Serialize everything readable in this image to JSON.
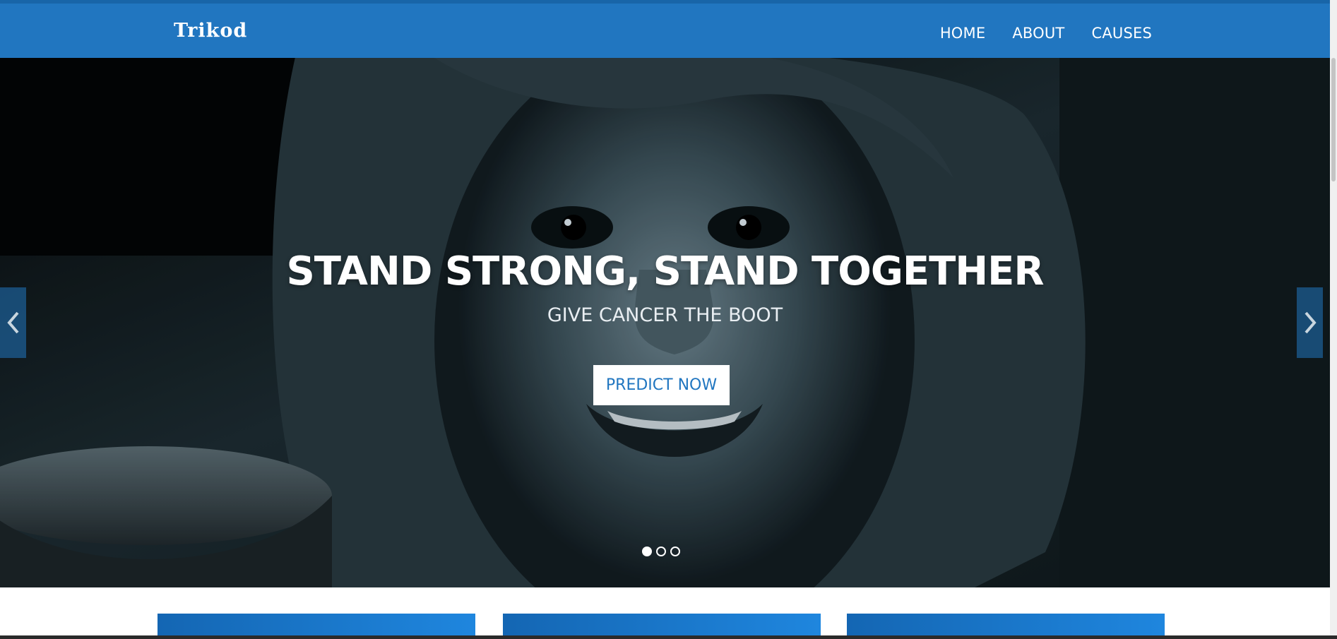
{
  "brand": {
    "logo_text": "Trikod"
  },
  "nav": {
    "items": [
      "HOME",
      "ABOUT",
      "CAUSES"
    ]
  },
  "hero": {
    "title": "STAND STRONG, STAND TOGETHER",
    "subtitle": "GIVE CANCER THE BOOT",
    "cta_label": "PREDICT NOW",
    "slide_count": 3,
    "active_slide": 1
  },
  "colors": {
    "brand_blue": "#2176c0",
    "top_strip": "#1865a8",
    "cta_background": "#ffffff",
    "cta_text": "#2176c0"
  },
  "icons": {
    "prev": "chevron-left-icon",
    "next": "chevron-right-icon"
  }
}
